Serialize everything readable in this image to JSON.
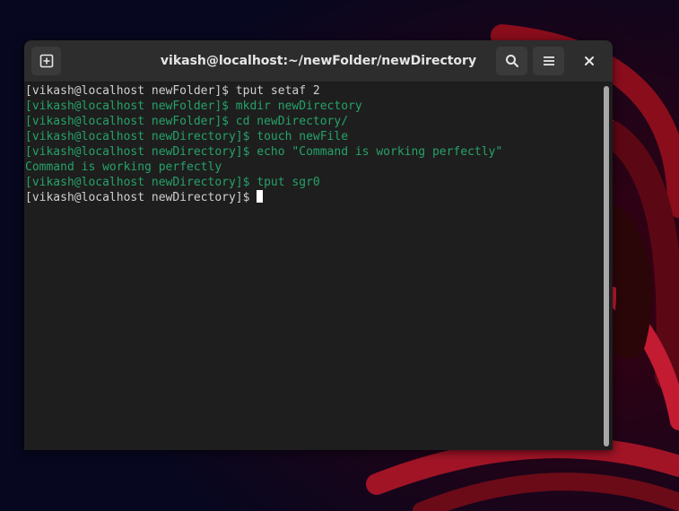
{
  "window": {
    "title": "vikash@localhost:~/newFolder/newDirectory"
  },
  "headerbar": {
    "new_tab_icon": "new-tab-icon",
    "search_icon": "search-icon",
    "menu_icon": "hamburger-menu-icon",
    "close_icon": "close-icon"
  },
  "terminal": {
    "lines": [
      {
        "text": "[vikash@localhost newFolder]$ tput setaf 2",
        "color": "#d0d0d0"
      },
      {
        "text": "[vikash@localhost newFolder]$ mkdir newDirectory",
        "color": "#26a269"
      },
      {
        "text": "[vikash@localhost newFolder]$ cd newDirectory/",
        "color": "#26a269"
      },
      {
        "text": "[vikash@localhost newDirectory]$ touch newFile",
        "color": "#26a269"
      },
      {
        "text": "[vikash@localhost newDirectory]$ echo \"Command is working perfectly\"",
        "color": "#26a269"
      },
      {
        "text": "Command is working perfectly",
        "color": "#26a269"
      },
      {
        "text": "[vikash@localhost newDirectory]$ tput sgr0",
        "color": "#26a269"
      }
    ],
    "prompt": "[vikash@localhost newDirectory]$ ",
    "input": ""
  },
  "colors": {
    "terminal_background": "#1e1e1e",
    "headerbar_background": "#2d2d2d",
    "default_text": "#d0d0d0",
    "green_text": "#26a269",
    "cursor": "#ffffff"
  }
}
